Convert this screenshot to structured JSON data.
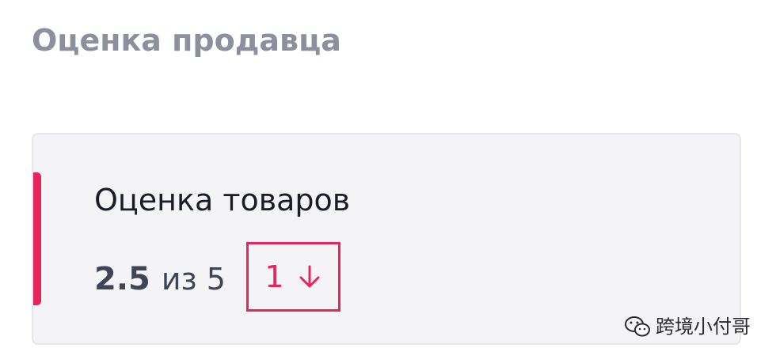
{
  "section": {
    "title": "Оценка продавца"
  },
  "card": {
    "title": "Оценка товаров",
    "score": "2.5",
    "of_label": "из",
    "max": "5",
    "change": {
      "value": "1",
      "direction_icon": "arrow-down-icon"
    }
  },
  "watermark": {
    "icon": "wechat-icon",
    "text": "跨境小付哥"
  },
  "colors": {
    "accent": "#e8245c",
    "title_gray": "#8c8f9c",
    "card_bg": "#f4f4f7",
    "text_dark": "#1b1d26",
    "score_text": "#3f4457"
  }
}
